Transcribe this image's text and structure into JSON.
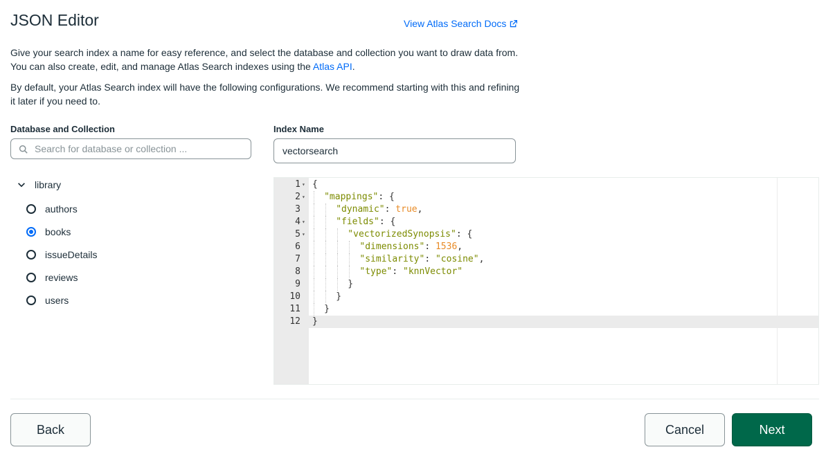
{
  "header": {
    "title": "JSON Editor",
    "docs_link": "View Atlas Search Docs"
  },
  "intro": {
    "p1_text": "Give your search index a name for easy reference, and select the database and collection you want to draw data from. You can also create, edit, and manage Atlas Search indexes using the ",
    "p1_link": "Atlas API",
    "p1_end": ".",
    "p2_text": "By default, your Atlas Search index will have the following configurations. We recommend starting with this and refining it later if you need to."
  },
  "database_collection": {
    "label": "Database and Collection",
    "search_placeholder": "Search for database or collection ...",
    "database": "library",
    "collections": [
      "authors",
      "books",
      "issueDetails",
      "reviews",
      "users"
    ],
    "selected": "books"
  },
  "index_name": {
    "label": "Index Name",
    "value": "vectorsearch"
  },
  "editor": {
    "active_line": 12,
    "lines": [
      {
        "n": "1",
        "fold": true,
        "indent": 0,
        "tokens": [
          [
            "p",
            "{"
          ]
        ]
      },
      {
        "n": "2",
        "fold": true,
        "indent": 1,
        "tokens": [
          [
            "k",
            "\"mappings\""
          ],
          [
            "p",
            ": {"
          ]
        ]
      },
      {
        "n": "3",
        "fold": false,
        "indent": 2,
        "tokens": [
          [
            "k",
            "\"dynamic\""
          ],
          [
            "p",
            ": "
          ],
          [
            "b",
            "true"
          ],
          [
            "p",
            ","
          ]
        ]
      },
      {
        "n": "4",
        "fold": true,
        "indent": 2,
        "tokens": [
          [
            "k",
            "\"fields\""
          ],
          [
            "p",
            ": {"
          ]
        ]
      },
      {
        "n": "5",
        "fold": true,
        "indent": 3,
        "tokens": [
          [
            "k",
            "\"vectorizedSynopsis\""
          ],
          [
            "p",
            ": {"
          ]
        ]
      },
      {
        "n": "6",
        "fold": false,
        "indent": 4,
        "tokens": [
          [
            "k",
            "\"dimensions\""
          ],
          [
            "p",
            ": "
          ],
          [
            "n",
            "1536"
          ],
          [
            "p",
            ","
          ]
        ]
      },
      {
        "n": "7",
        "fold": false,
        "indent": 4,
        "tokens": [
          [
            "k",
            "\"similarity\""
          ],
          [
            "p",
            ": "
          ],
          [
            "s",
            "\"cosine\""
          ],
          [
            "p",
            ","
          ]
        ]
      },
      {
        "n": "8",
        "fold": false,
        "indent": 4,
        "tokens": [
          [
            "k",
            "\"type\""
          ],
          [
            "p",
            ": "
          ],
          [
            "s",
            "\"knnVector\""
          ]
        ]
      },
      {
        "n": "9",
        "fold": false,
        "indent": 3,
        "tokens": [
          [
            "p",
            "}"
          ]
        ]
      },
      {
        "n": "10",
        "fold": false,
        "indent": 2,
        "tokens": [
          [
            "p",
            "}"
          ]
        ]
      },
      {
        "n": "11",
        "fold": false,
        "indent": 1,
        "tokens": [
          [
            "p",
            "}"
          ]
        ]
      },
      {
        "n": "12",
        "fold": false,
        "indent": 0,
        "tokens": [
          [
            "p",
            "}"
          ]
        ]
      }
    ]
  },
  "footer": {
    "back": "Back",
    "cancel": "Cancel",
    "next": "Next"
  },
  "colors": {
    "link": "#016bf8",
    "primary": "#00684a",
    "json_key": "#7c8b00",
    "json_literal": "#e88b27"
  },
  "icons": {
    "docs_link": "external-link-icon",
    "search": "search-icon",
    "tree_toggle": "chevron-down-icon",
    "fold": "fold-arrow-icon"
  }
}
